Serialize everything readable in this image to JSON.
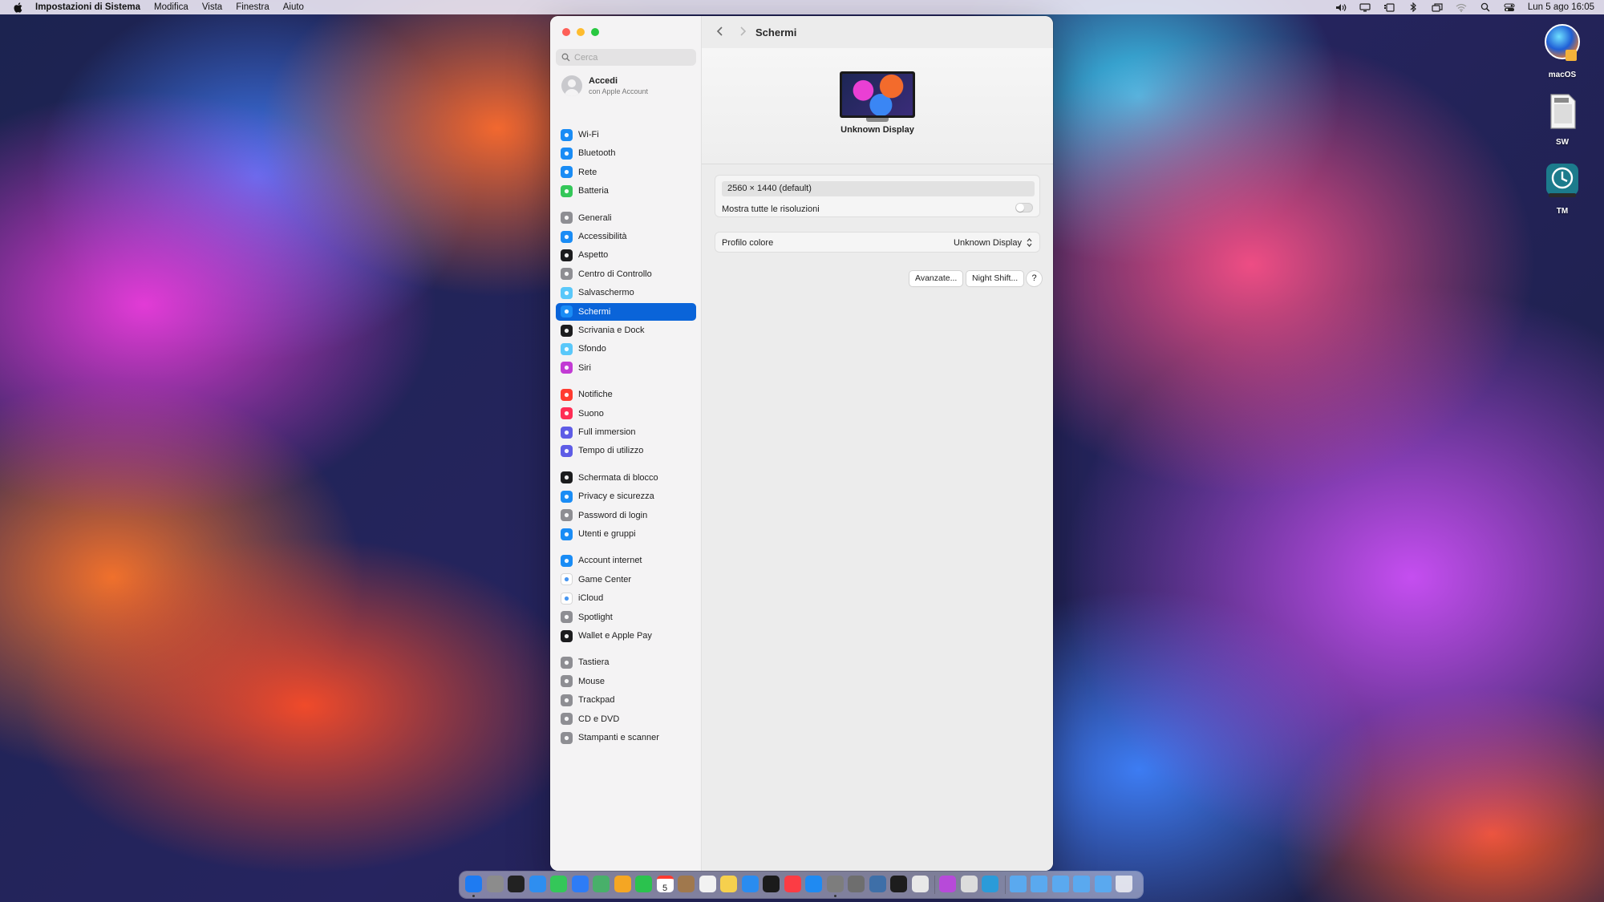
{
  "menubar": {
    "app_name": "Impostazioni di Sistema",
    "menus": [
      "Modifica",
      "Vista",
      "Finestra",
      "Aiuto"
    ],
    "clock": "Lun 5 ago  16:05"
  },
  "window": {
    "title": "Schermi",
    "search_placeholder": "Cerca",
    "account": {
      "title": "Accedi",
      "subtitle": "con Apple Account"
    },
    "sidebar": {
      "items": [
        {
          "label": "Wi-Fi",
          "icon": "wifi-icon",
          "color": "#1a8cf5"
        },
        {
          "label": "Bluetooth",
          "icon": "bluetooth-icon",
          "color": "#1a8cf5"
        },
        {
          "label": "Rete",
          "icon": "globe-icon",
          "color": "#1a8cf5"
        },
        {
          "label": "Batteria",
          "icon": "battery-icon",
          "color": "#34c759"
        },
        {
          "label": "Generali",
          "icon": "gear-icon",
          "color": "#8e8e93"
        },
        {
          "label": "Accessibilità",
          "icon": "accessibility-icon",
          "color": "#1a8cf5"
        },
        {
          "label": "Aspetto",
          "icon": "appearance-icon",
          "color": "#1c1c1e"
        },
        {
          "label": "Centro di Controllo",
          "icon": "control-center-icon",
          "color": "#8e8e93"
        },
        {
          "label": "Salvaschermo",
          "icon": "screensaver-icon",
          "color": "#5ac8fa"
        },
        {
          "label": "Schermi",
          "icon": "display-icon",
          "color": "#1a8cf5"
        },
        {
          "label": "Scrivania e Dock",
          "icon": "dock-icon",
          "color": "#1c1c1e"
        },
        {
          "label": "Sfondo",
          "icon": "wallpaper-icon",
          "color": "#5ac8fa"
        },
        {
          "label": "Siri",
          "icon": "siri-icon",
          "color": "#c23bd4"
        },
        {
          "label": "Notifiche",
          "icon": "notifications-icon",
          "color": "#ff3b30"
        },
        {
          "label": "Suono",
          "icon": "sound-icon",
          "color": "#ff2d55"
        },
        {
          "label": "Full immersion",
          "icon": "focus-icon",
          "color": "#5e5ce6"
        },
        {
          "label": "Tempo di utilizzo",
          "icon": "screen-time-icon",
          "color": "#5e5ce6"
        },
        {
          "label": "Schermata di blocco",
          "icon": "lock-screen-icon",
          "color": "#1c1c1e"
        },
        {
          "label": "Privacy e sicurezza",
          "icon": "privacy-hand-icon",
          "color": "#1a8cf5"
        },
        {
          "label": "Password di login",
          "icon": "lock-icon",
          "color": "#8e8e93"
        },
        {
          "label": "Utenti e gruppi",
          "icon": "users-icon",
          "color": "#1a8cf5"
        },
        {
          "label": "Account internet",
          "icon": "at-icon",
          "color": "#1a8cf5"
        },
        {
          "label": "Game Center",
          "icon": "game-center-icon",
          "color": "#ffffff"
        },
        {
          "label": "iCloud",
          "icon": "cloud-icon",
          "color": "#ffffff"
        },
        {
          "label": "Spotlight",
          "icon": "spotlight-icon",
          "color": "#8e8e93"
        },
        {
          "label": "Wallet e Apple Pay",
          "icon": "wallet-icon",
          "color": "#1c1c1e"
        },
        {
          "label": "Tastiera",
          "icon": "keyboard-icon",
          "color": "#8e8e93"
        },
        {
          "label": "Mouse",
          "icon": "mouse-icon",
          "color": "#8e8e93"
        },
        {
          "label": "Trackpad",
          "icon": "trackpad-icon",
          "color": "#8e8e93"
        },
        {
          "label": "CD e DVD",
          "icon": "cd-icon",
          "color": "#8e8e93"
        },
        {
          "label": "Stampanti e scanner",
          "icon": "printer-icon",
          "color": "#8e8e93"
        }
      ],
      "active": "Schermi"
    },
    "content": {
      "display_name": "Unknown Display",
      "resolution": "2560 × 1440 (default)",
      "show_all_label": "Mostra tutte le risoluzioni",
      "show_all_enabled": false,
      "color_profile_label": "Profilo colore",
      "color_profile_value": "Unknown Display",
      "advanced_button": "Avanzate...",
      "night_shift_button": "Night Shift...",
      "help_button": "?"
    }
  },
  "desktop_icons": [
    {
      "label": "macOS",
      "icon": "macos-disk-icon"
    },
    {
      "label": "SW",
      "icon": "sd-card-icon"
    },
    {
      "label": "TM",
      "icon": "time-machine-icon"
    }
  ],
  "dock": {
    "apps": [
      "finder-icon",
      "launchpad-icon",
      "mission-control-icon",
      "safari-icon",
      "messages-icon",
      "mail-icon",
      "maps-icon",
      "photos-icon",
      "facetime-icon",
      "calendar-icon",
      "contacts-icon",
      "reminders-icon",
      "notes-icon",
      "freeform-icon",
      "tv-icon",
      "music-icon",
      "app-store-icon",
      "system-settings-icon",
      "image-capture-icon",
      "screen-sharing-icon",
      "terminal-icon",
      "preview-icon",
      "colorsync-icon",
      "disk-utility-icon",
      "network-icon"
    ],
    "calendar_day": "5",
    "folders": [
      "folder-icon",
      "folder-icon",
      "folder-icon",
      "folder-icon",
      "folder-icon"
    ],
    "trash": "trash-icon",
    "colors": [
      "#1e7bf2",
      "#8c8c8c",
      "#222222",
      "#2e8ef0",
      "#34c759",
      "#2e7cf6",
      "#48b06a",
      "#f5a623",
      "#2bc24e",
      "#ffffff",
      "#a0784d",
      "#f2f2f2",
      "#f6d04d",
      "#2a8cf0",
      "#1b1b1b",
      "#fc3c44",
      "#1f8af2",
      "#7d7d7d",
      "#6e6e6e",
      "#3e6fa8",
      "#1d1d1d",
      "#e8e8e8",
      "#b74ad9",
      "#dcdcdc",
      "#2b9bd9"
    ]
  }
}
